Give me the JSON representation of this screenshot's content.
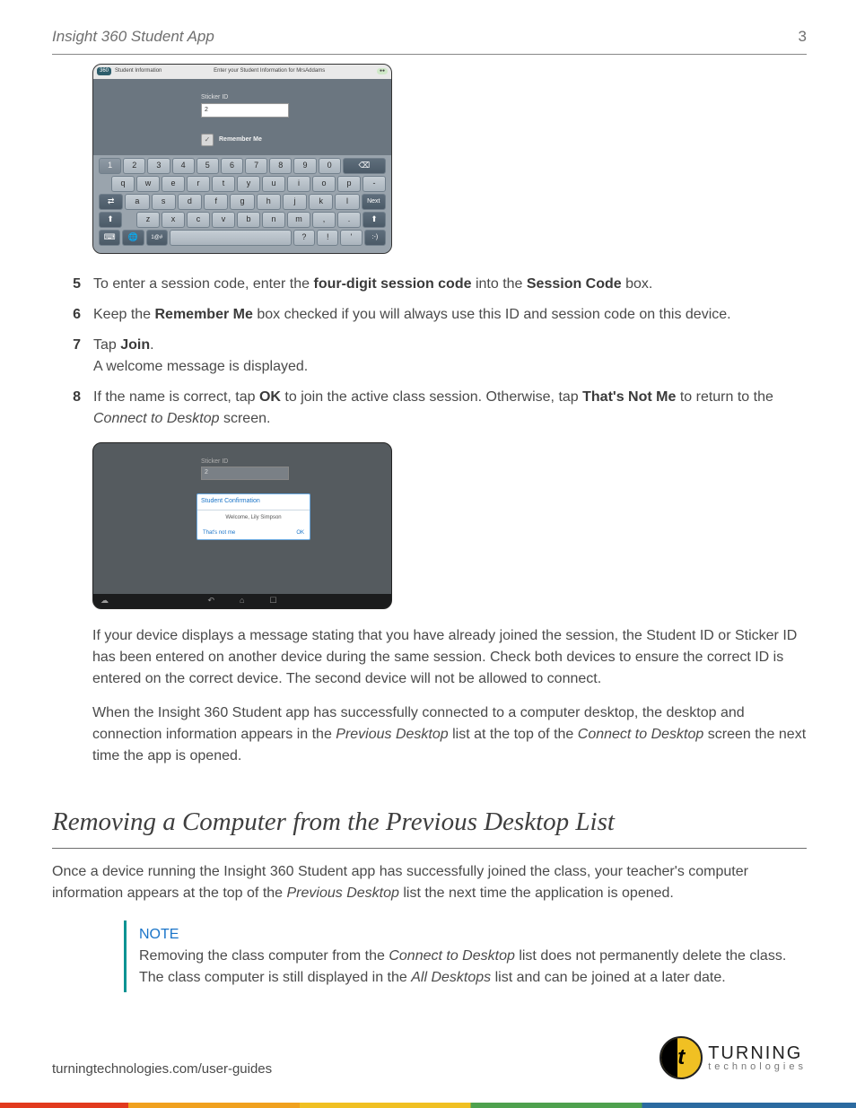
{
  "header": {
    "app_title": "Insight 360 Student App",
    "page_number": "3"
  },
  "fig1": {
    "titlebar": {
      "badge": "360",
      "left": "Student Information",
      "center": "Enter your Student Information for MrsAddams",
      "right_status": "●●"
    },
    "sticker_label": "Sticker ID",
    "sticker_value": "2",
    "remember_label": "Remember Me",
    "check_icon": "✓",
    "rows": {
      "r1": [
        "1",
        "2",
        "3",
        "4",
        "5",
        "6",
        "7",
        "8",
        "9",
        "0"
      ],
      "r1_back": "⌫",
      "r2": [
        "q",
        "w",
        "e",
        "r",
        "t",
        "y",
        "u",
        "i",
        "o",
        "p",
        "-"
      ],
      "r3_left": "⇄",
      "r3": [
        "a",
        "s",
        "d",
        "f",
        "g",
        "h",
        "j",
        "k",
        "l"
      ],
      "r3_next": "Next",
      "r4_shift": "⬆",
      "r4": [
        "z",
        "x",
        "c",
        "v",
        "b",
        "n",
        "m",
        ",",
        "."
      ],
      "r4_shift2": "⬆",
      "r5_kb": "⌨",
      "r5_globe": "🌐",
      "r5_sym": "1@#",
      "r5_space": "",
      "r5_q": "?",
      "r5_ex": "!",
      "r5_ap": "'",
      "r5_smile": ":-)"
    }
  },
  "steps": [
    {
      "n": "5",
      "pre": "To enter a session code, enter the ",
      "b1": "four-digit session code",
      "mid": " into the ",
      "b2": "Session Code",
      "post": " box."
    },
    {
      "n": "6",
      "pre": "Keep the ",
      "b1": "Remember Me",
      "mid": " box checked if you will always use this ID and session code on this device.",
      "b2": "",
      "post": ""
    },
    {
      "n": "7",
      "pre": "Tap ",
      "b1": "Join",
      "mid": ".",
      "b2": "",
      "post": "",
      "line2": "A welcome message is displayed."
    },
    {
      "n": "8",
      "pre": "If the name is correct, tap ",
      "b1": "OK",
      "mid": " to join the active class session. Otherwise, tap ",
      "b2": "That's Not Me",
      "post": " to return to the ",
      "i1": "Connect to Desktop",
      "tail": " screen."
    }
  ],
  "fig2": {
    "sticker_label": "Sticker ID",
    "sticker_value": "2",
    "dialog_title": "Student Confirmation",
    "dialog_msg": "Welcome, Lily Simpson",
    "btn_left": "That's not me",
    "btn_right": "OK",
    "nav": {
      "back": "↶",
      "home": "⌂",
      "recent": "☐",
      "ghost": "☁"
    }
  },
  "para1": "If your device displays a message stating that you have already joined the session, the Student ID or Sticker ID has been entered on another device during the same session. Check both devices to ensure the correct ID is entered on the correct device. The second device will not be allowed to connect.",
  "para2_pre": "When the Insight 360 Student app has successfully connected to a computer desktop, the desktop and connection information appears in the ",
  "para2_i1": "Previous Desktop",
  "para2_mid": " list at the top of the ",
  "para2_i2": "Connect to Desktop",
  "para2_post": " screen the next time the app is opened.",
  "section_heading": "Removing a Computer from the Previous Desktop List",
  "intro_pre": "Once a device running the Insight 360 Student app has successfully joined the class, your teacher's computer information appears at the top of the ",
  "intro_i": "Previous Desktop",
  "intro_post": " list the next time the application is opened.",
  "note": {
    "title": "NOTE",
    "pre": "Removing the class computer from the ",
    "i1": "Connect to Desktop",
    "mid": " list does not permanently delete the class. The class computer is still displayed in the ",
    "i2": "All Desktops",
    "post": " list and can be joined at a later date."
  },
  "footer": {
    "url": "turningtechnologies.com/user-guides",
    "logo_top": "TURNING",
    "logo_bot": "technologies",
    "icon_letter": "t"
  }
}
